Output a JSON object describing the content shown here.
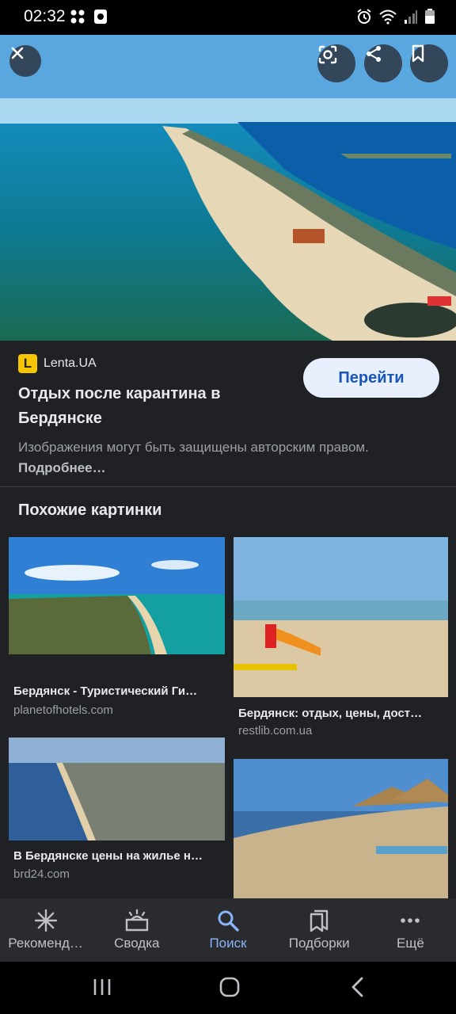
{
  "status_bar": {
    "time": "02:32"
  },
  "hero": {
    "alt_icon_names": [
      "close-icon",
      "lens-icon",
      "share-icon",
      "bookmark-icon"
    ]
  },
  "source": {
    "logo_letter": "L",
    "name": "Lenta.UA"
  },
  "result": {
    "title": "Отдых после карантина в Бердянске",
    "goto_label": "Перейти",
    "copyright_text": "Изображения могут быть защищены авторским правом.",
    "copyright_more": "Подробнее…"
  },
  "similar": {
    "heading": "Похожие картинки",
    "items": [
      {
        "caption": "Бердянск - Туристический Ги…",
        "domain": "planetofhotels.com"
      },
      {
        "caption": "Бердянск: отдых, цены, дост…",
        "domain": "restlib.com.ua"
      },
      {
        "caption": "В Бердянске цены на жилье н…",
        "domain": "brd24.com"
      },
      {
        "caption": "",
        "domain": ""
      }
    ]
  },
  "bottom_nav": {
    "items": [
      {
        "label": "Рекоменд…",
        "icon": "asterisk-icon"
      },
      {
        "label": "Сводка",
        "icon": "digest-icon"
      },
      {
        "label": "Поиск",
        "icon": "search-icon",
        "active": true
      },
      {
        "label": "Подборки",
        "icon": "collections-icon"
      },
      {
        "label": "Ещё",
        "icon": "more-icon"
      }
    ]
  },
  "colors": {
    "background": "#202124",
    "accent": "#8ab4f8",
    "button_bg": "#e8f0fe",
    "button_text": "#1a56b8"
  }
}
